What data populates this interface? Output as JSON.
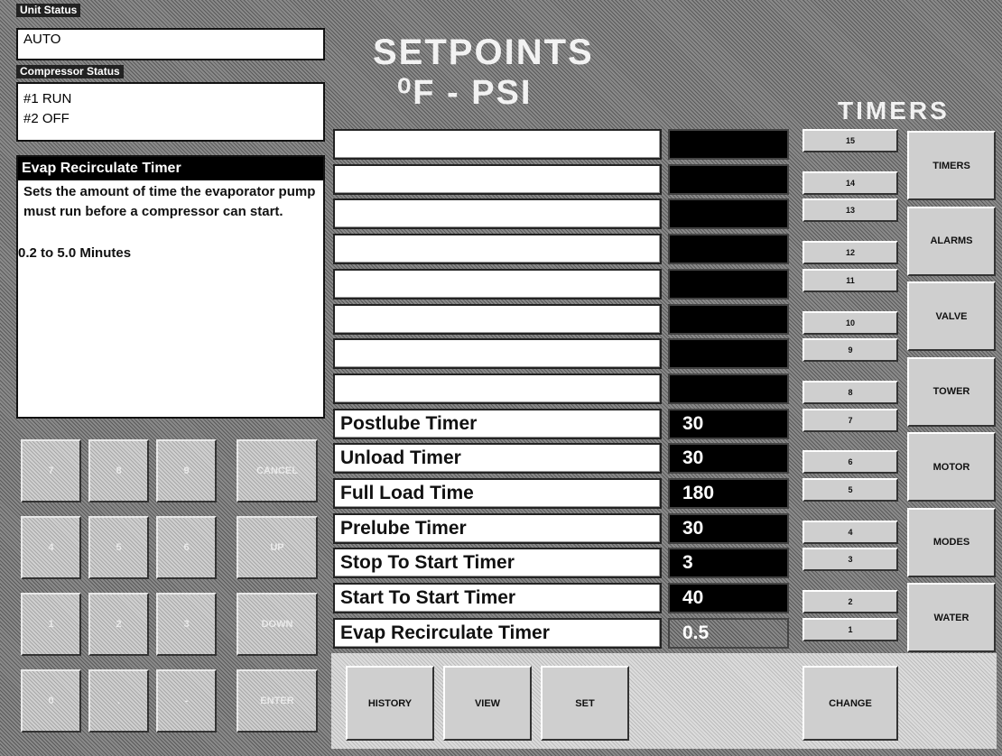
{
  "unit_status": {
    "label": "Unit Status",
    "value": "AUTO"
  },
  "compressor_status": {
    "label": "Compressor Status",
    "lines": [
      "#1 RUN",
      "#2 OFF"
    ]
  },
  "help": {
    "title": "Evap Recirculate Timer",
    "body": "Sets the amount of time the evaporator pump must run before a compressor can start.",
    "range": "0.2 to 5.0 Minutes"
  },
  "header": {
    "title_line1": "SETPOINTS",
    "title_line2": "⁰F - PSI",
    "section": "TIMERS"
  },
  "setpoints": [
    {
      "num": "15",
      "label": "",
      "value": ""
    },
    {
      "num": "14",
      "label": "",
      "value": ""
    },
    {
      "num": "13",
      "label": "",
      "value": ""
    },
    {
      "num": "12",
      "label": "",
      "value": ""
    },
    {
      "num": "11",
      "label": "",
      "value": ""
    },
    {
      "num": "10",
      "label": "",
      "value": ""
    },
    {
      "num": "9",
      "label": "",
      "value": ""
    },
    {
      "num": "8",
      "label": "",
      "value": ""
    },
    {
      "num": "7",
      "label": "Postlube Timer",
      "value": "30"
    },
    {
      "num": "6",
      "label": "Unload Timer",
      "value": "30"
    },
    {
      "num": "5",
      "label": "Full Load Time",
      "value": "180"
    },
    {
      "num": "4",
      "label": "Prelube Timer",
      "value": "30"
    },
    {
      "num": "3",
      "label": "Stop To Start Timer",
      "value": "3"
    },
    {
      "num": "2",
      "label": "Start To Start Timer",
      "value": "40"
    },
    {
      "num": "1",
      "label": "Evap Recirculate Timer",
      "value": "0.5"
    }
  ],
  "selected_setpoint": "1",
  "side_buttons": [
    "TIMERS",
    "ALARMS",
    "VALVE",
    "TOWER",
    "MOTOR",
    "MODES",
    "WATER"
  ],
  "keypad": [
    [
      "7",
      "8",
      "9",
      "CANCEL"
    ],
    [
      "4",
      "5",
      "6",
      "UP"
    ],
    [
      "1",
      "2",
      "3",
      "DOWN"
    ],
    [
      "0",
      ".",
      "-",
      "ENTER"
    ]
  ],
  "bottom_buttons": {
    "history": "HISTORY",
    "view": "VIEW",
    "set": "SET",
    "change": "CHANGE"
  }
}
